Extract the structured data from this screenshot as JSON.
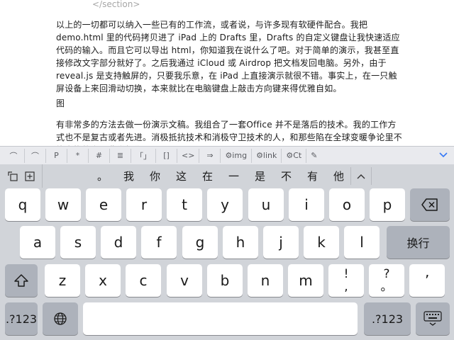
{
  "document": {
    "closing_tag": "</section>",
    "paragraph1": "以上的一切都可以纳入一些已有的工作流，或者说，与许多现有软硬件配合。我把 demo.html 里的代码拷贝进了 iPad 上的 Drafts 里，Drafts 的自定义键盘让我快速适应代码的输入。而且它可以导出 html，你知道我在说什么了吧。对于简单的演示，我甚至直接修改文字部分就好了。之后我通过 iCloud 或 Airdrop 把文档发回电脑。另外，由于 reveal.js 是支持触屏的，只要我乐意，在 iPad 上直接演示就很不错。事实上，在一只触屏设备上来回滑动切换，本来就比在电脑键盘上敲击方向键来得优雅自如。",
    "paragraph2": "图",
    "paragraph3": "有非常多的方法去做一份演示文稿。我组合了一套Office 并不是落后的技术。我的工作方式也不是复古或者先进。消极抵抗技术和消极守卫技术的人，和那些陷在全球变暖争论里不能自拔的家伙非常相像。"
  },
  "toolbar": {
    "items": [
      "⌒",
      "⌒",
      "P",
      "*",
      "#",
      "≣",
      "「」",
      "[]",
      "<>",
      "⇒",
      "⚙img",
      "⚙link",
      "⚙Ct",
      "✎"
    ]
  },
  "candidates": {
    "words": [
      "。",
      "我",
      "你",
      "这",
      "在",
      "一",
      "是",
      "不",
      "有",
      "他"
    ]
  },
  "keyboard": {
    "row1": [
      "q",
      "w",
      "e",
      "r",
      "t",
      "y",
      "u",
      "i",
      "o",
      "p"
    ],
    "row2": [
      "a",
      "s",
      "d",
      "f",
      "g",
      "h",
      "j",
      "k",
      "l"
    ],
    "row3": [
      "z",
      "x",
      "c",
      "v",
      "b",
      "n",
      "m"
    ],
    "return_label": "换行",
    "numbers_label": ".?123",
    "punct1_top": "!",
    "punct1_bottom": ",",
    "punct2_top": "?",
    "punct2_bottom": "。",
    "punct3": "’"
  }
}
